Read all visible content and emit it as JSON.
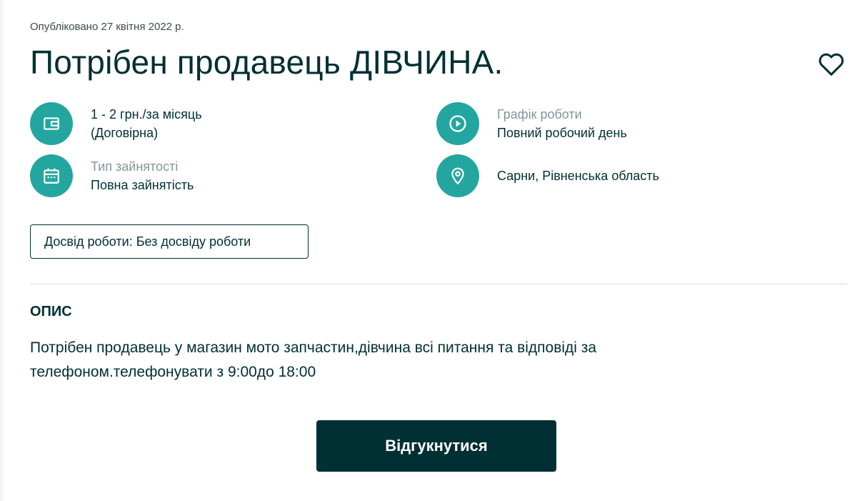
{
  "published": "Опубліковано 27 квітня 2022 р.",
  "title": "Потрібен продавець ДІВЧИНА.",
  "favorite_icon": "heart-icon",
  "features": {
    "salary": {
      "icon": "wallet-icon",
      "line1": "1 - 2 грн./за місяць",
      "line2": "(Договірна)"
    },
    "schedule": {
      "icon": "clock-icon",
      "label": "Графік роботи",
      "value": "Повний робочий день"
    },
    "employment": {
      "icon": "calendar-icon",
      "label": "Тип зайнятості",
      "value": "Повна зайнятість"
    },
    "location": {
      "icon": "location-pin-icon",
      "value": "Сарни, Рівненська область"
    }
  },
  "experience_tag": "Досвід роботи: Без досвіду роботи",
  "description": {
    "title": "ОПИС",
    "line1": "Потрібен продавець у магазин мото запчастин,дівчина всі питання та відповіді за",
    "line2": "телефоном.телефонувати з 9:00до 18:00"
  },
  "respond_button": "Відгукнутися",
  "colors": {
    "accent": "#23a6a0",
    "text": "#002f34",
    "muted": "#7f9799",
    "button_bg": "#002f34",
    "button_text": "#ffffff"
  }
}
